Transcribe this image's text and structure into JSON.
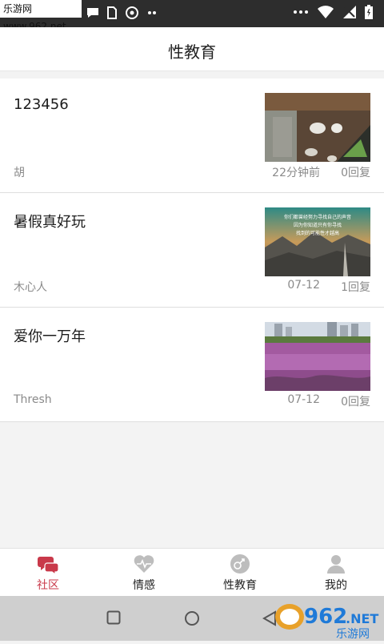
{
  "watermark_top": "乐游网 www.962.net",
  "status_bar": {
    "icons": [
      "message-icon",
      "sim-icon",
      "app-icon",
      "more-icon",
      "wifi-icon",
      "no-signal-icon",
      "battery-icon"
    ]
  },
  "header": {
    "title": "性教育"
  },
  "posts": [
    {
      "title": "123456",
      "author": "胡",
      "time": "22分钟前",
      "replies": "0回复"
    },
    {
      "title": "暑假真好玩",
      "author": "木心人",
      "time": "07-12",
      "replies": "1回复",
      "thumb_text": "你们都曾经努力寻找自己的声音\n因为你知道只有你寻找\n找到的可能性才越高"
    },
    {
      "title": "爱你一万年",
      "author": "Thresh",
      "time": "07-12",
      "replies": "0回复"
    }
  ],
  "tabs": [
    {
      "label": "社区",
      "icon": "chat-bubbles-icon",
      "active": true
    },
    {
      "label": "情感",
      "icon": "heartbeat-icon",
      "active": false
    },
    {
      "label": "性教育",
      "icon": "gender-icon",
      "active": false
    },
    {
      "label": "我的",
      "icon": "person-icon",
      "active": false
    }
  ],
  "nav": {
    "icons": [
      "recent-apps-icon",
      "home-icon",
      "back-icon"
    ]
  },
  "watermark_br": {
    "number": "962",
    "suffix": ".NET",
    "text": "乐游网"
  },
  "colors": {
    "accent": "#c9394a",
    "status_bar": "#2d2d2d",
    "inactive_icon": "#bdbdbd"
  }
}
